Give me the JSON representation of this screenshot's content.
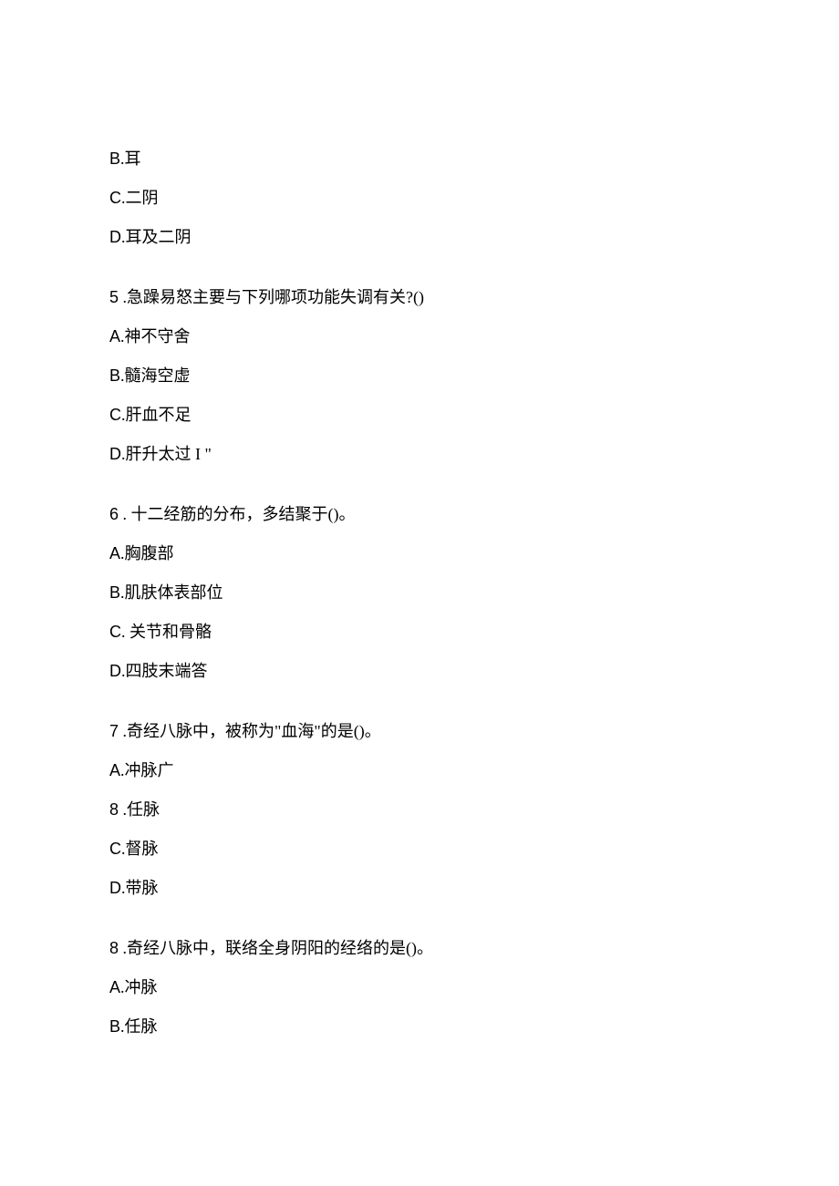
{
  "partial_options_top": [
    {
      "letter": "B",
      "text": "耳"
    },
    {
      "letter": "C",
      "text": "二阴"
    },
    {
      "letter": "D",
      "text": "耳及二阴"
    }
  ],
  "questions": [
    {
      "number": "5",
      "text": " .急躁易怒主要与下列哪项功能失调有关?()",
      "options": [
        {
          "letter": "A",
          "text": "神不守舍"
        },
        {
          "letter": "B",
          "text": "髓海空虚"
        },
        {
          "letter": "C",
          "text": "肝血不足"
        },
        {
          "letter": "D",
          "text": "肝升太过 I       \""
        }
      ]
    },
    {
      "number": "6",
      "text": " . 十二经筋的分布，多结聚于()。",
      "options": [
        {
          "letter": "A",
          "text": "胸腹部"
        },
        {
          "letter": "B",
          "text": "肌肤体表部位"
        },
        {
          "letter": "C",
          "text": " 关节和骨骼"
        },
        {
          "letter": "D",
          "text": "四肢末端答"
        }
      ]
    },
    {
      "number": "7",
      "text": " .奇经八脉中，被称为\"血海\"的是()。",
      "options": [
        {
          "letter": "A",
          "text": "冲脉广"
        },
        {
          "letter": "8",
          "text": " .任脉"
        },
        {
          "letter": "C",
          "text": "督脉"
        },
        {
          "letter": "D",
          "text": "带脉"
        }
      ]
    },
    {
      "number": "8",
      "text": " .奇经八脉中，联络全身阴阳的经络的是()。",
      "options": [
        {
          "letter": "A",
          "text": "冲脉"
        },
        {
          "letter": "B",
          "text": "任脉"
        }
      ]
    }
  ]
}
